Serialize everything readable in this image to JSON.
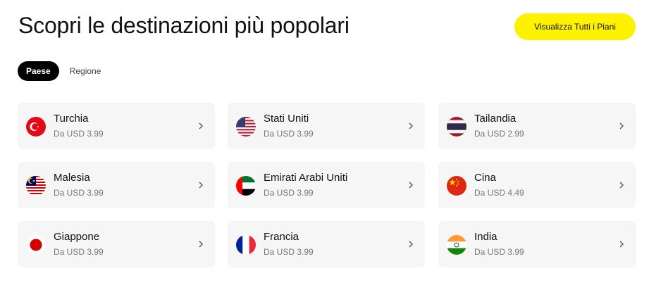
{
  "header": {
    "title": "Scopri le destinazioni più popolari",
    "view_all_label": "Visualizza Tutti i Piani"
  },
  "tabs": [
    {
      "label": "Paese",
      "active": true
    },
    {
      "label": "Regione",
      "active": false
    }
  ],
  "destinations": [
    {
      "name": "Turchia",
      "price": "Da USD 3.99",
      "flag": "turkey-flag-icon"
    },
    {
      "name": "Stati Uniti",
      "price": "Da USD 3.99",
      "flag": "usa-flag-icon"
    },
    {
      "name": "Tailandia",
      "price": "Da USD 2.99",
      "flag": "thailand-flag-icon"
    },
    {
      "name": "Malesia",
      "price": "Da USD 3.99",
      "flag": "malaysia-flag-icon"
    },
    {
      "name": "Emirati Arabi Uniti",
      "price": "Da USD 3.99",
      "flag": "uae-flag-icon"
    },
    {
      "name": "Cina",
      "price": "Da USD 4.49",
      "flag": "china-flag-icon"
    },
    {
      "name": "Giappone",
      "price": "Da USD 3.99",
      "flag": "japan-flag-icon"
    },
    {
      "name": "Francia",
      "price": "Da USD 3.99",
      "flag": "france-flag-icon"
    },
    {
      "name": "India",
      "price": "Da USD 3.99",
      "flag": "india-flag-icon"
    }
  ],
  "colors": {
    "accent": "#fff200",
    "card_bg": "#f6f6f7",
    "active_tab": "#000000"
  }
}
